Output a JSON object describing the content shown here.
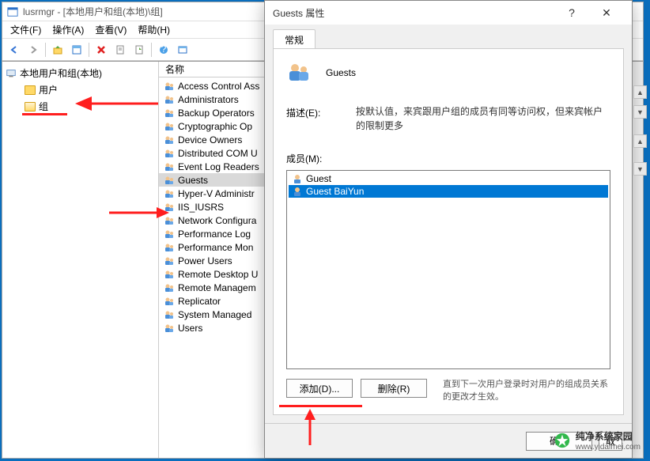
{
  "main": {
    "title": "lusrmgr - [本地用户和组(本地)\\组]",
    "menus": [
      "文件(F)",
      "操作(A)",
      "查看(V)",
      "帮助(H)"
    ],
    "tree": {
      "root": "本地用户和组(本地)",
      "children": [
        "用户",
        "组"
      ]
    },
    "list": {
      "header": "名称",
      "items": [
        "Access Control Ass",
        "Administrators",
        "Backup Operators",
        "Cryptographic Op",
        "Device Owners",
        "Distributed COM U",
        "Event Log Readers",
        "Guests",
        "Hyper-V Administr",
        "IIS_IUSRS",
        "Network Configura",
        "Performance Log",
        "Performance Mon",
        "Power Users",
        "Remote Desktop U",
        "Remote Managem",
        "Replicator",
        "System Managed",
        "Users"
      ],
      "selected": 7
    }
  },
  "dialog": {
    "title": "Guests 属性",
    "tab": "常规",
    "header": "Guests",
    "desc_label": "描述(E):",
    "desc_text": "按默认值，来宾跟用户组的成员有同等访问权，但来宾帐户的限制更多",
    "members_label": "成员(M):",
    "members": [
      "Guest",
      "Guest BaiYun"
    ],
    "selected_member": 1,
    "add_btn": "添加(D)...",
    "remove_btn": "删除(R)",
    "note": "直到下一次用户登录时对用户的组成员关系的更改才生效。",
    "ok": "确定",
    "cancel_partial": "取"
  },
  "watermark": {
    "brand": "纯净系统家园",
    "url": "www.yidaimei.com"
  }
}
